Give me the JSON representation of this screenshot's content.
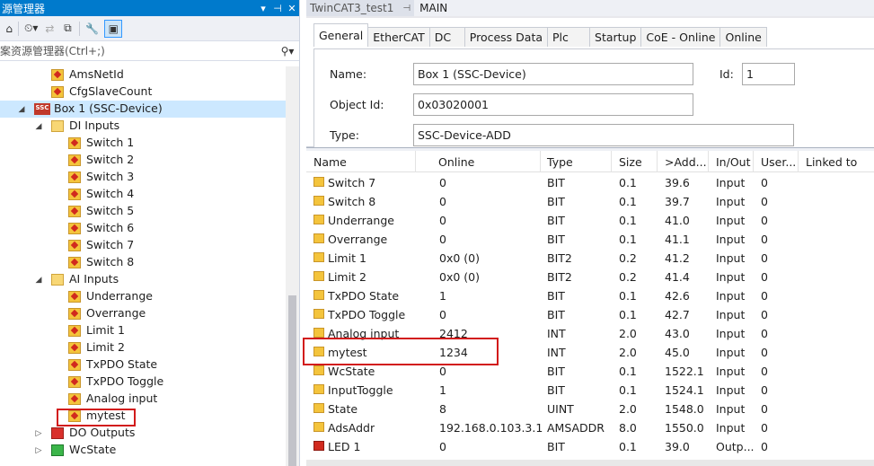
{
  "solution_explorer": {
    "title": "源管理器",
    "search_placeholder": "案资源管理器(Ctrl+;)",
    "tree": [
      {
        "label": "AmsNetId",
        "icon": "variable-icon",
        "level": 3
      },
      {
        "label": "CfgSlaveCount",
        "icon": "variable-icon",
        "level": 3
      },
      {
        "label": "Box 1 (SSC-Device)",
        "icon": "ssc-device-icon",
        "level": 2,
        "expanded": true,
        "selected": true
      },
      {
        "label": "DI Inputs",
        "icon": "folder-icon",
        "level": 3,
        "expanded": true
      },
      {
        "label": "Switch 1",
        "icon": "variable-icon",
        "level": 4
      },
      {
        "label": "Switch 2",
        "icon": "variable-icon",
        "level": 4
      },
      {
        "label": "Switch 3",
        "icon": "variable-icon",
        "level": 4
      },
      {
        "label": "Switch 4",
        "icon": "variable-icon",
        "level": 4
      },
      {
        "label": "Switch 5",
        "icon": "variable-icon",
        "level": 4
      },
      {
        "label": "Switch 6",
        "icon": "variable-icon",
        "level": 4
      },
      {
        "label": "Switch 7",
        "icon": "variable-icon",
        "level": 4
      },
      {
        "label": "Switch 8",
        "icon": "variable-icon",
        "level": 4
      },
      {
        "label": "AI Inputs",
        "icon": "folder-icon",
        "level": 3,
        "expanded": true
      },
      {
        "label": "Underrange",
        "icon": "variable-icon",
        "level": 4
      },
      {
        "label": "Overrange",
        "icon": "variable-icon",
        "level": 4
      },
      {
        "label": "Limit 1",
        "icon": "variable-icon",
        "level": 4
      },
      {
        "label": "Limit 2",
        "icon": "variable-icon",
        "level": 4
      },
      {
        "label": "TxPDO State",
        "icon": "variable-icon",
        "level": 4
      },
      {
        "label": "TxPDO Toggle",
        "icon": "variable-icon",
        "level": 4
      },
      {
        "label": "Analog input",
        "icon": "variable-icon",
        "level": 4
      },
      {
        "label": "mytest",
        "icon": "variable-icon",
        "level": 4
      },
      {
        "label": "DO Outputs",
        "icon": "output-folder-icon",
        "level": 3,
        "expanded": false
      },
      {
        "label": "WcState",
        "icon": "wcstate-folder-icon",
        "level": 3,
        "expanded": false
      }
    ]
  },
  "document_tabs": [
    {
      "label": "TwinCAT3_test1",
      "pin": "⊣"
    },
    {
      "label": "MAIN"
    }
  ],
  "property_tabs": [
    "General",
    "EtherCAT",
    "DC",
    "Process Data",
    "Plc",
    "Startup",
    "CoE - Online",
    "Online"
  ],
  "general": {
    "name_label": "Name:",
    "name_value": "Box 1 (SSC-Device)",
    "id_label": "Id:",
    "id_value": "1",
    "objectid_label": "Object Id:",
    "objectid_value": "0x03020001",
    "type_label": "Type:",
    "type_value": "SSC-Device-ADD"
  },
  "grid": {
    "columns": [
      "Name",
      "Online",
      "Type",
      "Size",
      ">Add...",
      "In/Out",
      "User...",
      "Linked to"
    ],
    "rows": [
      {
        "name": "Switch 7",
        "online": "0",
        "type": "BIT",
        "size": "0.1",
        "addr": "39.6",
        "inout": "Input",
        "user": "0",
        "icon": "input-var-icon"
      },
      {
        "name": "Switch 8",
        "online": "0",
        "type": "BIT",
        "size": "0.1",
        "addr": "39.7",
        "inout": "Input",
        "user": "0",
        "icon": "input-var-icon"
      },
      {
        "name": "Underrange",
        "online": "0",
        "type": "BIT",
        "size": "0.1",
        "addr": "41.0",
        "inout": "Input",
        "user": "0",
        "icon": "input-var-icon"
      },
      {
        "name": "Overrange",
        "online": "0",
        "type": "BIT",
        "size": "0.1",
        "addr": "41.1",
        "inout": "Input",
        "user": "0",
        "icon": "input-var-icon"
      },
      {
        "name": "Limit 1",
        "online": "0x0 (0)",
        "type": "BIT2",
        "size": "0.2",
        "addr": "41.2",
        "inout": "Input",
        "user": "0",
        "icon": "input-var-icon"
      },
      {
        "name": "Limit 2",
        "online": "0x0 (0)",
        "type": "BIT2",
        "size": "0.2",
        "addr": "41.4",
        "inout": "Input",
        "user": "0",
        "icon": "input-var-icon"
      },
      {
        "name": "TxPDO State",
        "online": "1",
        "type": "BIT",
        "size": "0.1",
        "addr": "42.6",
        "inout": "Input",
        "user": "0",
        "icon": "input-var-icon"
      },
      {
        "name": "TxPDO Toggle",
        "online": "0",
        "type": "BIT",
        "size": "0.1",
        "addr": "42.7",
        "inout": "Input",
        "user": "0",
        "icon": "input-var-icon"
      },
      {
        "name": "Analog input",
        "online": "2412",
        "type": "INT",
        "size": "2.0",
        "addr": "43.0",
        "inout": "Input",
        "user": "0",
        "icon": "input-var-icon"
      },
      {
        "name": "mytest",
        "online": "1234",
        "type": "INT",
        "size": "2.0",
        "addr": "45.0",
        "inout": "Input",
        "user": "0",
        "icon": "input-var-icon"
      },
      {
        "name": "WcState",
        "online": "0",
        "type": "BIT",
        "size": "0.1",
        "addr": "1522.1",
        "inout": "Input",
        "user": "0",
        "icon": "input-var-icon"
      },
      {
        "name": "InputToggle",
        "online": "1",
        "type": "BIT",
        "size": "0.1",
        "addr": "1524.1",
        "inout": "Input",
        "user": "0",
        "icon": "input-var-icon"
      },
      {
        "name": "State",
        "online": "8",
        "type": "UINT",
        "size": "2.0",
        "addr": "1548.0",
        "inout": "Input",
        "user": "0",
        "icon": "input-var-icon"
      },
      {
        "name": "AdsAddr",
        "online": "192.168.0.103.3.1...",
        "type": "AMSADDR",
        "size": "8.0",
        "addr": "1550.0",
        "inout": "Input",
        "user": "0",
        "icon": "input-var-icon"
      },
      {
        "name": "LED 1",
        "online": "0",
        "type": "BIT",
        "size": "0.1",
        "addr": "39.0",
        "inout": "Outp...",
        "user": "0",
        "icon": "output-var-icon"
      }
    ]
  }
}
